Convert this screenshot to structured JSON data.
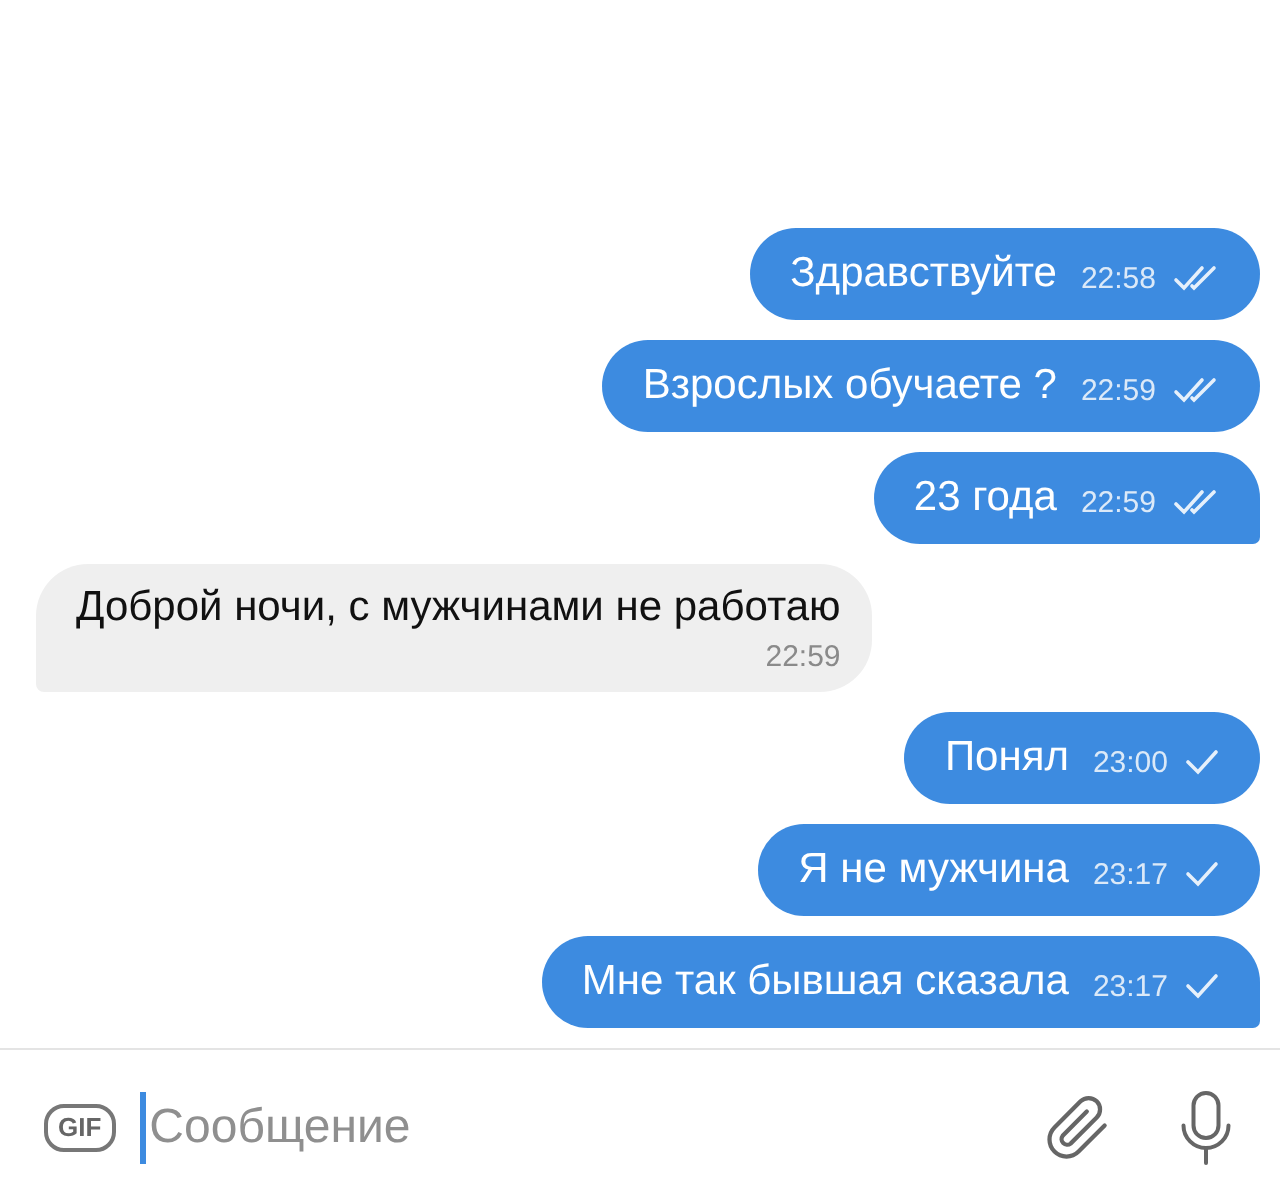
{
  "messages": [
    {
      "kind": "outgoing",
      "text": "Здравствуйте",
      "time": "22:58",
      "read": true
    },
    {
      "kind": "outgoing",
      "text": "Взрослых обучаете ?",
      "time": "22:59",
      "read": true
    },
    {
      "kind": "outgoing",
      "text": "23 года",
      "time": "22:59",
      "read": true
    },
    {
      "kind": "incoming",
      "text": "Доброй ночи, с мужчинами не работаю",
      "time": "22:59"
    },
    {
      "kind": "outgoing",
      "text": "Понял",
      "time": "23:00",
      "read": false
    },
    {
      "kind": "outgoing",
      "text": "Я не мужчина",
      "time": "23:17",
      "read": false
    },
    {
      "kind": "outgoing",
      "text": "Мне так бывшая сказала",
      "time": "23:17",
      "read": false
    }
  ],
  "composer": {
    "gif_label": "GIF",
    "placeholder": "Сообщение"
  }
}
